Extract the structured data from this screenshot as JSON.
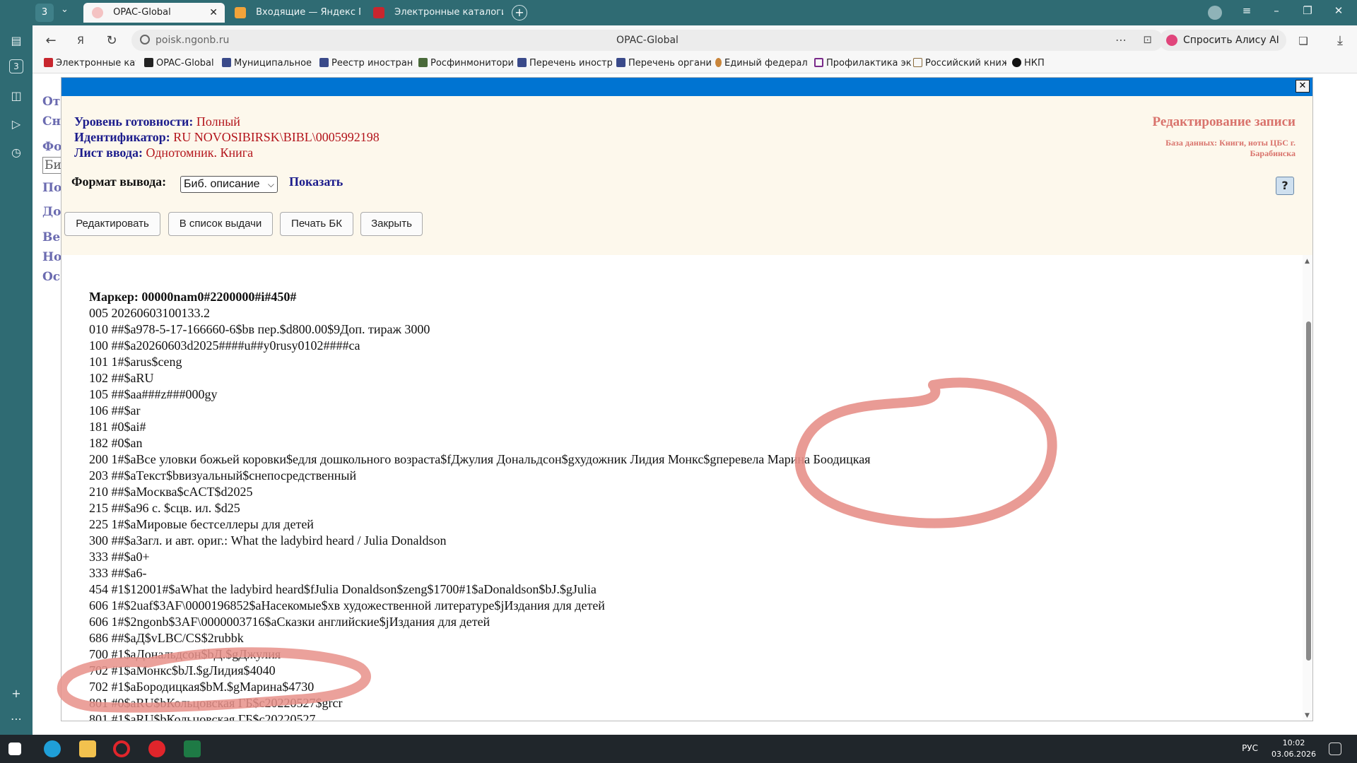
{
  "browser": {
    "tab_count_badge": "3",
    "tabs": [
      {
        "label": "OPAC-Global",
        "active": true
      },
      {
        "label": "Входящие — Яндекс Почт",
        "active": false
      },
      {
        "label": "Электронные каталоги Р",
        "active": false
      }
    ],
    "url_host": "poisk.ngonb.ru",
    "page_title": "OPAC-Global",
    "alice_label": "Спросить Алису AI",
    "bookmarks": [
      "Электронные кат",
      "OPAC-Global",
      "Муниципальное",
      "Реестр иностран",
      "Росфинмонитори",
      "Перечень иностр",
      "Перечень органи",
      "Единый федерал",
      "Профилактика эк",
      "Российский книж",
      "НКП"
    ],
    "sidebar_badge": "3"
  },
  "background_links": [
    "От",
    "Сн",
    "Фо",
    "Би",
    "По",
    "До",
    "Ве",
    "Но",
    "Ос"
  ],
  "dialog": {
    "close_glyph": "✕",
    "readiness_label": "Уровень готовности:",
    "readiness_value": "Полный",
    "identifier_label": "Идентификатор:",
    "identifier_value": "RU NOVOSIBIRSK\\BIBL\\0005992198",
    "input_sheet_label": "Лист ввода:",
    "input_sheet_value": "Однотомник. Книга",
    "edit_title": "Редактирование записи",
    "database": "База данных: Книги, ноты ЦБС г. Барабинска",
    "format_label": "Формат вывода:",
    "format_selected": "Биб. описание",
    "show_link": "Показать",
    "buttons": {
      "edit": "Редактировать",
      "to_list": "В список выдачи",
      "print": "Печать БК",
      "close": "Закрыть"
    }
  },
  "record": {
    "marker": "Маркер: 00000nam0#2200000#i#450#",
    "lines": [
      "005 20260603100133.2",
      "010 ##$a978-5-17-166660-6$bв пер.$d800.00$9Доп. тираж 3000",
      "100 ##$a20260603d2025####u##y0rusy0102####ca",
      "101 1#$arus$ceng",
      "102 ##$aRU",
      "105 ##$aa###z###000gy",
      "106 ##$ar",
      "181 #0$ai#",
      "182 #0$an",
      "200 1#$aВсе уловки божьей коровки$eдля дошкольного возраста$fДжулия Дональдсон$gхудожник Лидия Монкс$gперевела Марина Боодицкая",
      "203 ##$aТекст$bвизуальный$cнепосредственный",
      "210 ##$aМосква$cACT$d2025",
      "215 ##$a96 с. $cцв. ил. $d25",
      "225 1#$aМировые бестселлеры для детей",
      "300 ##$aЗагл. и авт. ориг.: What the ladybird heard / Julia Donaldson",
      "333 ##$a0+",
      "333 ##$a6-",
      "454 #1$12001#$aWhat the ladybird heard$fJulia Donaldson$zeng$1700#1$aDonaldson$bJ.$gJulia",
      "606 1#$2uaf$3AF\\0000196852$aНасекомые$xв художественной литературе$jИздания для детей",
      "606 1#$2ngonb$3AF\\0000003716$aСказки английские$jИздания для детей",
      "686 ##$aД$vLBC/CS$2rubbk",
      "700 #1$aДональдсон$bД.$gДжулия",
      "702 #1$aМонкс$bЛ.$gЛидия$4040",
      "702 #1$aБородицкая$bМ.$gМарина$4730",
      "801 #0$aRU$bКольцовская ГБ$c20220527$grcr",
      "801 #1$aRU$bКольцовская ГБ$c20220527"
    ]
  },
  "taskbar": {
    "lang": "РУС",
    "time": "10:02",
    "date": "03.06.2026"
  },
  "colors": {
    "browser_chrome": "#2f6b73",
    "dialog_header": "#0074d2",
    "dialog_bg": "#fdf8ec",
    "label_blue": "#1c1c8c",
    "value_red": "#b3141b",
    "annotation": "#e7908a"
  }
}
